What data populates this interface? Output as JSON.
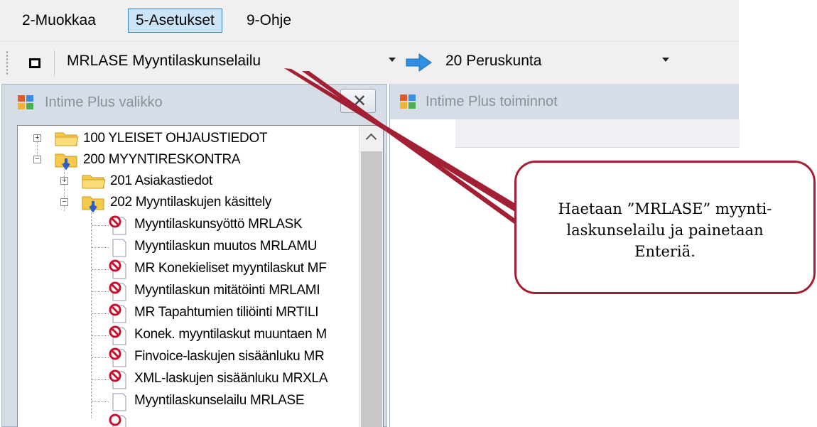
{
  "menubar": {
    "items": [
      {
        "label": "2-Muokkaa",
        "active": false
      },
      {
        "label": "5-Asetukset",
        "active": true
      },
      {
        "label": "9-Ohje",
        "active": false
      }
    ]
  },
  "toolbar": {
    "program_value": "MRLASE Myyntilaskunselailu",
    "company_value": "20 Peruskunta",
    "stop_icon": "stop-icon",
    "go_icon": "arrow-right-icon"
  },
  "left_panel": {
    "title": "Intime Plus valikko",
    "close_glyph": "✕",
    "tree": [
      {
        "label": "100 YLEISET OHJAUSTIEDOT",
        "icon": "folder-icon"
      },
      {
        "label": "200 MYYNTIRESKONTRA",
        "icon": "folder-open-icon"
      },
      {
        "label": "201 Asiakastiedot",
        "icon": "folder-icon"
      },
      {
        "label": "202 Myyntilaskujen käsittely",
        "icon": "folder-open-icon"
      },
      {
        "label": "Myyntilaskunsyöttö MRLASK",
        "icon": "document-blocked-icon"
      },
      {
        "label": "Myyntilaskun muutos MRLAMU",
        "icon": "document-icon"
      },
      {
        "label": "MR Konekieliset myyntilaskut MF",
        "icon": "document-blocked-icon"
      },
      {
        "label": "Myyntilaskun mitätöinti MRLAMI",
        "icon": "document-blocked-icon"
      },
      {
        "label": "MR Tapahtumien tiliöinti MRTILI",
        "icon": "document-blocked-icon"
      },
      {
        "label": "Konek. myyntilaskut muuntaen M",
        "icon": "document-blocked-icon"
      },
      {
        "label": "Finvoice-laskujen sisäänluku MR",
        "icon": "document-blocked-icon"
      },
      {
        "label": "XML-laskujen sisäänluku MRXLA",
        "icon": "document-blocked-icon"
      },
      {
        "label": "Myyntilaskunselailu MRLASE",
        "icon": "document-icon"
      }
    ]
  },
  "right_panel": {
    "title": "Intime Plus toiminnot"
  },
  "callout": {
    "text_line1": "Haetaan ”MRLASE” myynti-",
    "text_line2": "laskunselailu ja painetaan",
    "text_line3": "Enteriä.",
    "border_color": "#a31f34"
  },
  "colors": {
    "menu_active_bg": "#cce4f7",
    "panel_header_bg": "#d7dde6",
    "folder_yellow": "#f6c94a",
    "blocked_red": "#c8102e",
    "go_arrow_blue": "#2f8fe0"
  }
}
